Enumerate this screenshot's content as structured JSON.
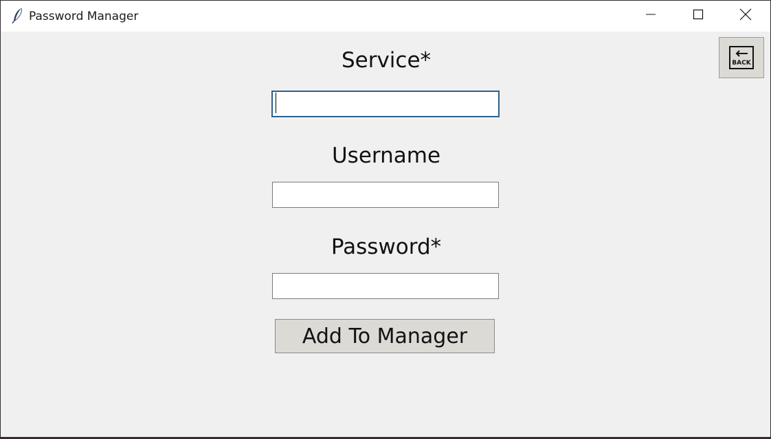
{
  "window": {
    "title": "Password Manager",
    "app_icon": "feather-icon",
    "controls": {
      "minimize_icon": "minimize-icon",
      "maximize_icon": "maximize-icon",
      "close_icon": "close-icon"
    }
  },
  "form": {
    "service": {
      "label": "Service*",
      "value": ""
    },
    "username": {
      "label": "Username",
      "value": ""
    },
    "password": {
      "label": "Password*",
      "value": ""
    },
    "submit_label": "Add To Manager"
  },
  "back_button": {
    "icon": "back-arrow-icon",
    "text": "BACK"
  }
}
